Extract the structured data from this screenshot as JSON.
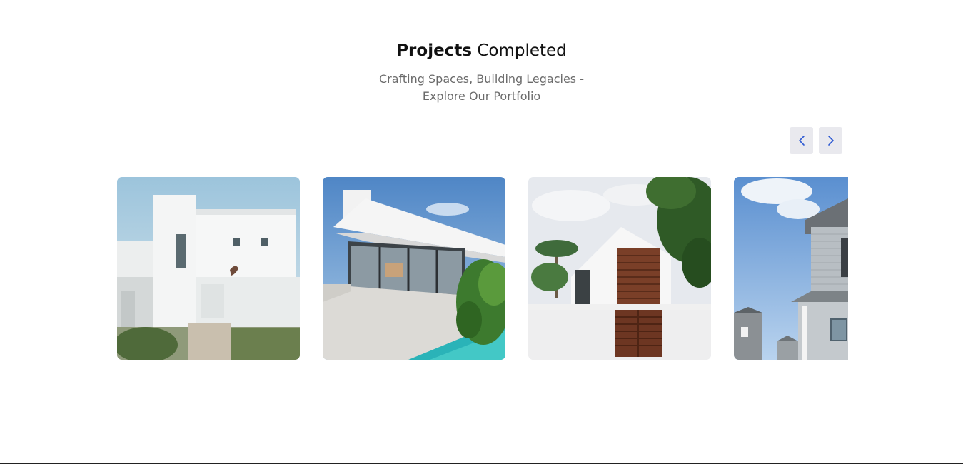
{
  "section": {
    "title_strong": "Projects",
    "title_light": "Completed",
    "subtitle_line1": "Crafting Spaces, Building Legacies -",
    "subtitle_line2": "Explore Our Portfolio"
  },
  "navigation": {
    "prev_icon": "chevron-left-icon",
    "next_icon": "chevron-right-icon",
    "accent_color": "#2f5bd3"
  },
  "projects": [
    {
      "image": "white-modern-villa-photo"
    },
    {
      "image": "glass-patio-house-with-pool-photo"
    },
    {
      "image": "white-house-wooden-shutters-photo"
    },
    {
      "image": "grey-suburban-house-photo"
    }
  ]
}
